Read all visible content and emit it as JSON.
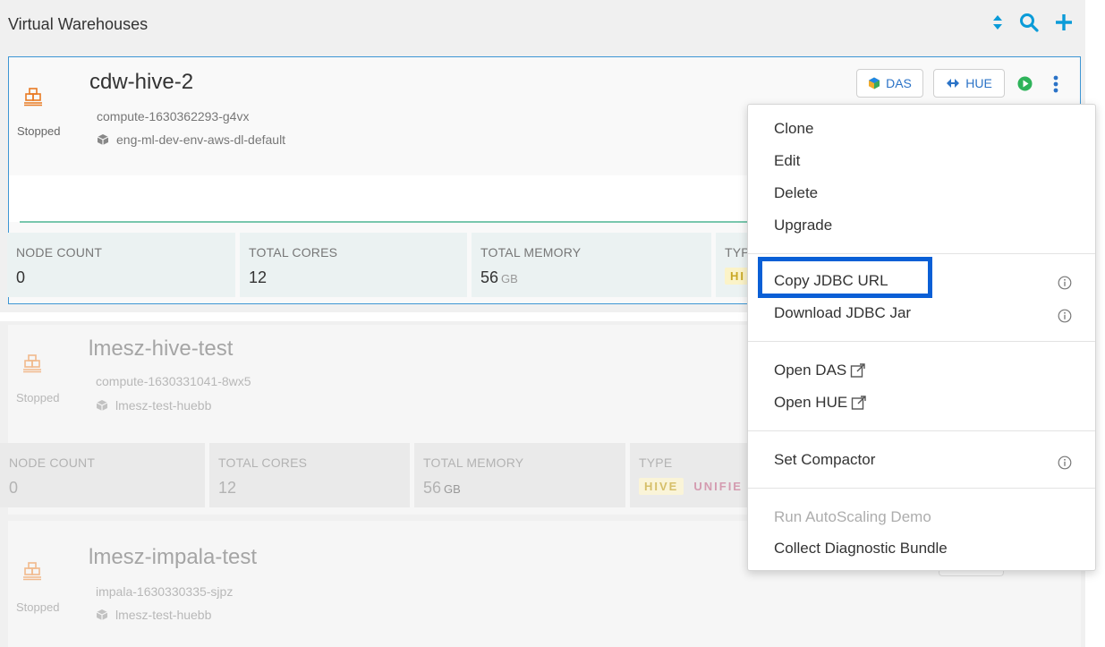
{
  "header": {
    "title": "Virtual Warehouses",
    "colors": {
      "accent": "#0a9bd8",
      "highlight": "#0a5fd6"
    }
  },
  "warehouses": [
    {
      "name": "cdw-hive-2",
      "compute_id": "compute-1630362293-g4vx",
      "environment": "eng-ml-dev-env-aws-dl-default",
      "status": "Stopped",
      "stats": [
        {
          "label": "NODE COUNT",
          "value": "0",
          "unit": ""
        },
        {
          "label": "TOTAL CORES",
          "value": "12",
          "unit": ""
        },
        {
          "label": "TOTAL MEMORY",
          "value": "56",
          "unit": "GB"
        },
        {
          "label": "TYP",
          "value": "",
          "unit": ""
        }
      ],
      "type_badge": "HI",
      "actions": {
        "das_label": "DAS",
        "hue_label": "HUE"
      }
    },
    {
      "name": "lmesz-hive-test",
      "compute_id": "compute-1630331041-8wx5",
      "environment": "lmesz-test-huebb",
      "status": "Stopped",
      "stats": [
        {
          "label": "NODE COUNT",
          "value": "0",
          "unit": ""
        },
        {
          "label": "TOTAL CORES",
          "value": "12",
          "unit": ""
        },
        {
          "label": "TOTAL MEMORY",
          "value": "56",
          "unit": "GB"
        },
        {
          "label": "TYPE",
          "value": "",
          "unit": ""
        }
      ],
      "type_badges": [
        "HIVE",
        "UNIFIE"
      ]
    },
    {
      "name": "lmesz-impala-test",
      "compute_id": "impala-1630330335-sjpz",
      "environment": "lmesz-test-huebb",
      "status": "Stopped"
    }
  ],
  "menu": {
    "items": [
      {
        "label": "Clone"
      },
      {
        "label": "Edit"
      },
      {
        "label": "Delete"
      },
      {
        "label": "Upgrade"
      },
      {
        "label": "Copy JDBC URL"
      },
      {
        "label": "Download JDBC Jar"
      },
      {
        "label": "Open DAS"
      },
      {
        "label": "Open HUE"
      },
      {
        "label": "Set Compactor"
      },
      {
        "label": "Run AutoScaling Demo"
      },
      {
        "label": "Collect Diagnostic Bundle"
      }
    ]
  }
}
